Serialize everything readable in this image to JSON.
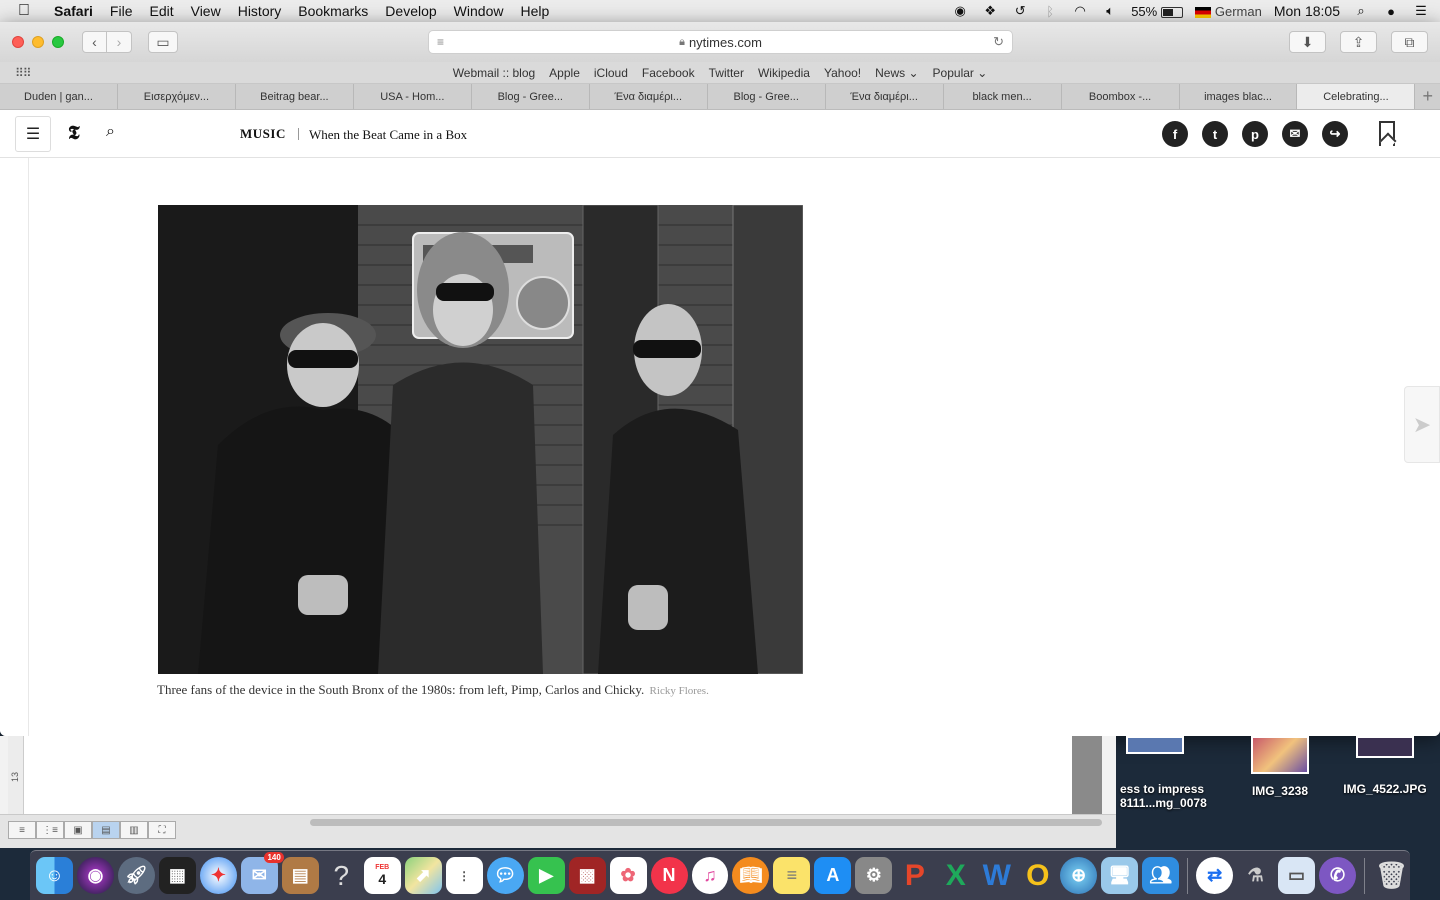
{
  "menubar": {
    "app": "Safari",
    "items": [
      "File",
      "Edit",
      "View",
      "History",
      "Bookmarks",
      "Develop",
      "Window",
      "Help"
    ],
    "battery": "55%",
    "input_source": "German",
    "clock": "Mon 18:05"
  },
  "browser": {
    "url": "nytimes.com",
    "favorites": [
      "Webmail :: blog",
      "Apple",
      "iCloud",
      "Facebook",
      "Twitter",
      "Wikipedia",
      "Yahoo!",
      "News ⌄",
      "Popular ⌄"
    ],
    "tabs": [
      {
        "label": "Duden | gan..."
      },
      {
        "label": "Εισερχόμεν..."
      },
      {
        "label": "Beitrag bear..."
      },
      {
        "label": "USA - Hom..."
      },
      {
        "label": "Blog - Gree..."
      },
      {
        "label": "Ένα διαμέρι..."
      },
      {
        "label": "Blog - Gree..."
      },
      {
        "label": "Ένα διαμέρι..."
      },
      {
        "label": "black men..."
      },
      {
        "label": "Boombox -..."
      },
      {
        "label": "images blac..."
      },
      {
        "label": "Celebrating..."
      }
    ],
    "active_tab": 11
  },
  "article": {
    "section": "MUSIC",
    "headline": "When the Beat Came in a Box",
    "caption": "Three fans of the device in the South Bronx of the 1980s: from left, Pimp, Carlos and Chicky.",
    "credit": "Ricky Flores.",
    "share": [
      "f",
      "t",
      "p",
      "✉",
      "↪"
    ]
  },
  "background": {
    "ruler_number": "13"
  },
  "desktop": {
    "items": [
      {
        "label": "ess to impress\n8111...mg_0078"
      },
      {
        "label": "IMG_3238"
      },
      {
        "label": "IMG_4522.JPG"
      }
    ]
  },
  "dock": {
    "mail_badge": "140",
    "calendar_month": "FEB",
    "calendar_day": "4"
  }
}
